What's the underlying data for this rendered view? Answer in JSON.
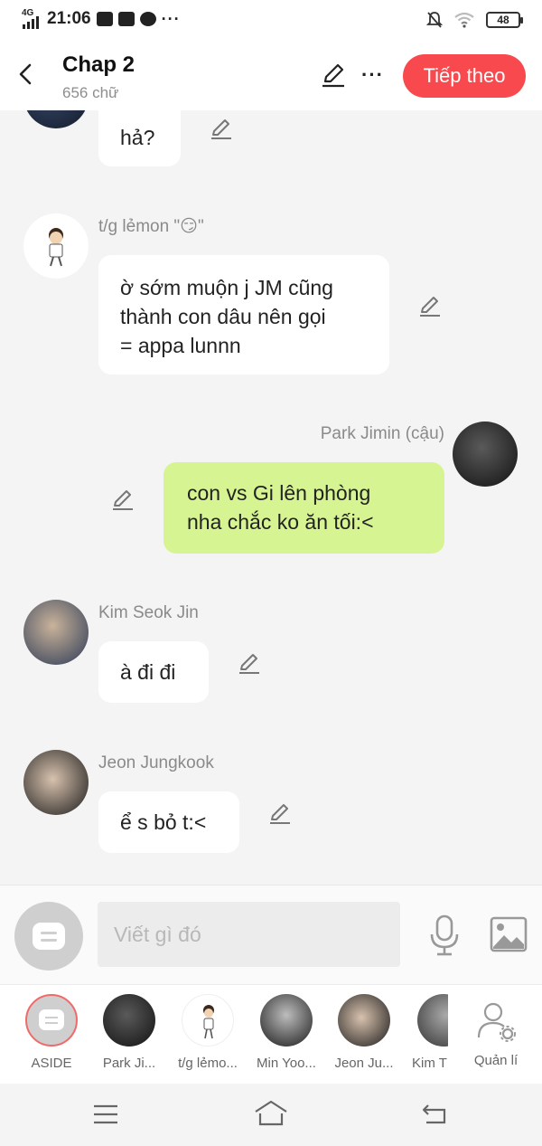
{
  "status_bar": {
    "network": "4G",
    "time": "21:06",
    "extra": "···",
    "battery": "48"
  },
  "header": {
    "title": "Chap 2",
    "word_count": "656 chữ",
    "next_button": "Tiếp theo"
  },
  "messages": [
    {
      "sender": "",
      "text": "hả?",
      "side": "left"
    },
    {
      "sender": "t/g lẻmon \"😏\"",
      "text": "ờ sớm muộn j JM cũng\nthành con dâu nên gọi\n= appa lunnn",
      "side": "left"
    },
    {
      "sender": "Park Jimin (cậu)",
      "text": "con vs Gi lên phòng\nnha chắc ko ăn tối:<",
      "side": "right"
    },
    {
      "sender": "Kim Seok Jin",
      "text": "à đi đi",
      "side": "left"
    },
    {
      "sender": "Jeon Jungkook",
      "text": "ể s bỏ t:<",
      "side": "left"
    }
  ],
  "composer": {
    "placeholder": "Viết gì đó"
  },
  "characters": [
    {
      "label": "ASIDE"
    },
    {
      "label": "Park Ji..."
    },
    {
      "label": "t/g lẻmo..."
    },
    {
      "label": "Min Yoo..."
    },
    {
      "label": "Jeon Ju..."
    },
    {
      "label": "Kim T"
    },
    {
      "label": "Quản lí"
    }
  ],
  "colors": {
    "accent": "#f84a4e",
    "my_bubble": "#d6f592",
    "other_bubble": "#ffffff"
  },
  "icons": [
    "back-arrow-icon",
    "pencil-icon",
    "more-icon",
    "chat-icon",
    "microphone-icon",
    "image-icon",
    "manage-characters-icon",
    "menu-icon",
    "home-icon",
    "back-nav-icon"
  ]
}
